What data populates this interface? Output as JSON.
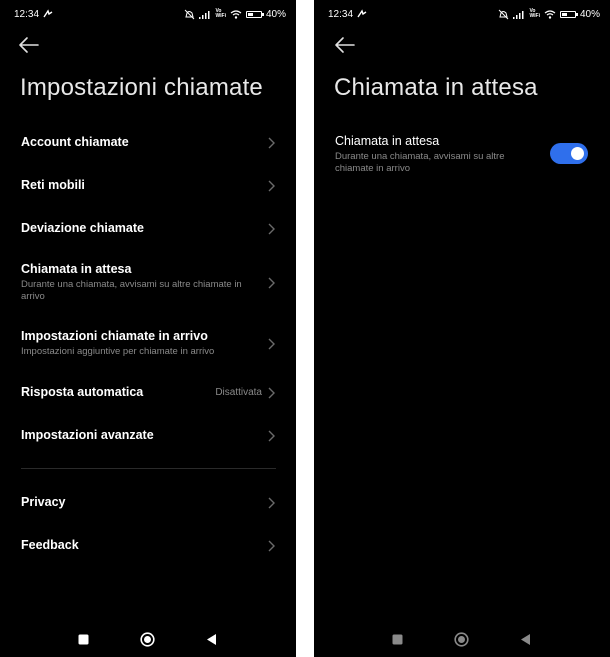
{
  "left_screen": {
    "status": {
      "time": "12:34",
      "battery": "40%",
      "battery_level": 0.4,
      "volte": "Vo\nWiFi"
    },
    "title": "Impostazioni chiamate",
    "items": [
      {
        "label": "Account chiamate",
        "subtitle": "",
        "value": ""
      },
      {
        "label": "Reti mobili",
        "subtitle": "",
        "value": ""
      },
      {
        "label": "Deviazione chiamate",
        "subtitle": "",
        "value": ""
      },
      {
        "label": "Chiamata in attesa",
        "subtitle": "Durante una chiamata, avvisami su altre chiamate in arrivo",
        "value": ""
      },
      {
        "label": "Impostazioni chiamate in arrivo",
        "subtitle": "Impostazioni aggiuntive per chiamate in arrivo",
        "value": ""
      },
      {
        "label": "Risposta automatica",
        "subtitle": "",
        "value": "Disattivata"
      },
      {
        "label": "Impostazioni avanzate",
        "subtitle": "",
        "value": ""
      },
      {
        "label": "Privacy",
        "subtitle": "",
        "value": ""
      },
      {
        "label": "Feedback",
        "subtitle": "",
        "value": ""
      }
    ]
  },
  "right_screen": {
    "status": {
      "time": "12:34",
      "battery": "40%",
      "battery_level": 0.4,
      "volte": "Vo\nWiFi"
    },
    "title": "Chiamata in attesa",
    "setting": {
      "label": "Chiamata in attesa",
      "subtitle": "Durante una chiamata, avvisami su altre chiamate in arrivo",
      "enabled": true
    }
  },
  "colors": {
    "background": "#000000",
    "toggle_on": "#2f6fec",
    "secondary_text": "#8a8a8a"
  },
  "icons": [
    "back-arrow-icon",
    "chevron-right-icon",
    "square-recents-icon",
    "circle-home-icon",
    "triangle-back-icon",
    "mute-icon",
    "signal-icon",
    "wifi-icon",
    "battery-icon",
    "data-saver-icon"
  ]
}
